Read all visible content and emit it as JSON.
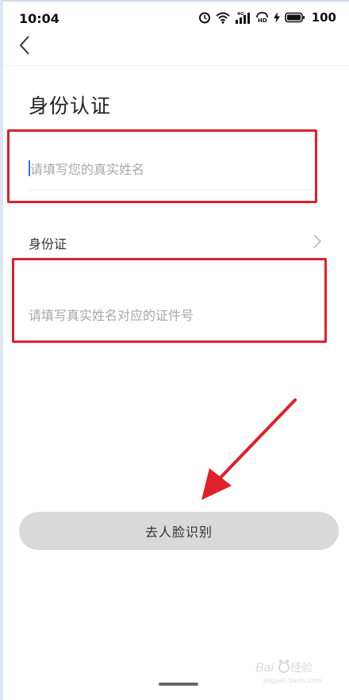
{
  "status_bar": {
    "time": "10:04",
    "network_label": "4G",
    "hd_label": "HD",
    "battery_level": "100",
    "icons": [
      "alarm-icon",
      "wifi-icon",
      "cellular-signal-icon",
      "hd-icon",
      "charging-icon",
      "battery-icon"
    ]
  },
  "header": {
    "back_icon": "chevron-left-icon"
  },
  "page": {
    "title": "身份认证"
  },
  "form": {
    "name_placeholder": "请填写您的真实姓名",
    "name_value": "",
    "id_type_label": "身份证",
    "id_type_icon": "chevron-right-icon",
    "id_number_placeholder": "请填写真实姓名对应的证件号",
    "id_number_value": ""
  },
  "actions": {
    "face_button_label": "去人脸识别"
  },
  "annotations": {
    "box_color": "#e0202a",
    "arrow_color": "#e0202a"
  },
  "watermark": {
    "text": "Baidu 经验",
    "subtext": "jingyan.baidu.com"
  },
  "colors": {
    "button_bg": "#d9d9d9",
    "placeholder": "#a8a8a8",
    "cursor": "#3b6cf0"
  }
}
